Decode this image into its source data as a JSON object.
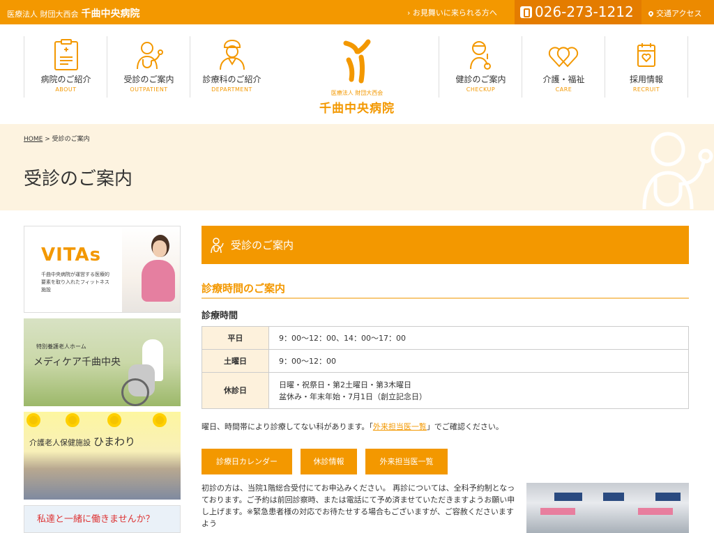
{
  "topbar": {
    "org_small": "医療法人 財団大西会",
    "org_name": "千曲中央病院",
    "visit_link": "お見舞いに来られる方へ",
    "tel": "026-273-1212",
    "access": "交通アクセス"
  },
  "nav_left": [
    {
      "jp": "病院のご紹介",
      "en": "ABOUT"
    },
    {
      "jp": "受診のご案内",
      "en": "OUTPATIENT"
    },
    {
      "jp": "診療科のご紹介",
      "en": "DEPARTMENT"
    }
  ],
  "nav_right": [
    {
      "jp": "健診のご案内",
      "en": "CHECKUP"
    },
    {
      "jp": "介護・福祉",
      "en": "CARE"
    },
    {
      "jp": "採用情報",
      "en": "RECRUIT"
    }
  ],
  "logo": {
    "small": "医療法人 財団大西会",
    "name": "千曲中央病院"
  },
  "breadcrumb": {
    "home": "HOME",
    "sep": ">",
    "current": "受診のご案内"
  },
  "page_title": "受診のご案内",
  "sidebar": {
    "vitas": {
      "logo": "VITAs",
      "desc": "千曲中央病院が運営する医療的要素を取り入れたフィットネス施設"
    },
    "medicare": {
      "sub": "特別養護老人ホーム",
      "title": "メディケア千曲中央"
    },
    "himawari": {
      "sub": "介護老人保健施設",
      "title": "ひまわり"
    },
    "recruit": {
      "title": "私達と一緒に働きませんか？"
    }
  },
  "content": {
    "section_title": "受診のご案内",
    "h2": "診療時間のご案内",
    "h3": "診療時間",
    "hours": [
      {
        "label": "平日",
        "value": "9：00〜12：00、14：00〜17：00"
      },
      {
        "label": "土曜日",
        "value": "9：00〜12：00"
      },
      {
        "label": "休診日",
        "line1": "日曜・祝祭日・第2土曜日・第3木曜日",
        "line2": "盆休み・年末年始・7月1日（創立記念日）"
      }
    ],
    "note": {
      "before": "曜日、時間帯により診療してない科があります。「",
      "link": "外来担当医一覧",
      "after": "」でご確認ください。"
    },
    "buttons": [
      "診療日カレンダー",
      "休診情報",
      "外来担当医一覧"
    ],
    "para": "初診の方は、当院1階総合受付にてお申込みください。 再診については、全科予約制となっております。ご予約は前回診察時、または電話にて予め済ませていただきますようお願い申し上げます。※緊急患者様の対応でお待たせする場合もございますが、ご容赦くださいますよう"
  },
  "colors": {
    "brand": "#f39800",
    "brand_dark": "#e47c00",
    "hero_bg": "#fdf3e0",
    "table_head": "#fdf1dc"
  }
}
